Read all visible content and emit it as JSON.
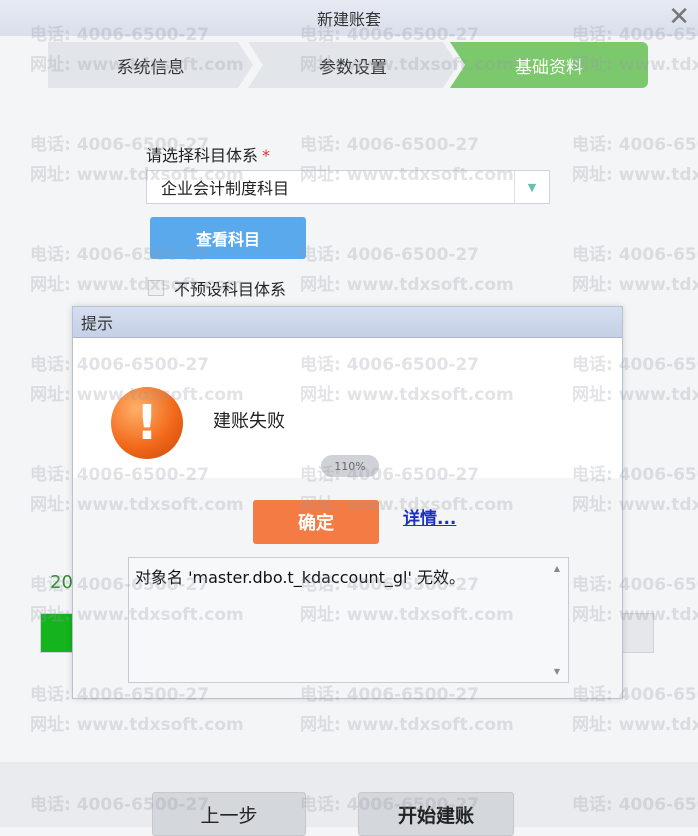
{
  "window": {
    "title": "新建账套",
    "close_glyph": "✕"
  },
  "steps": [
    {
      "label": "系统信息",
      "state": "done"
    },
    {
      "label": "参数设置",
      "state": "done"
    },
    {
      "label": "基础资料",
      "state": "active"
    }
  ],
  "form": {
    "subject_system_label": "请选择科目体系",
    "required_mark": "*",
    "subject_system_value": "企业会计制度科目",
    "view_subjects_button": "查看科目",
    "no_preset_label": "不预设科目体系"
  },
  "progress": {
    "value_label": "20",
    "fraction": 0.07
  },
  "footer": {
    "prev_button": "上一步",
    "start_button": "开始建账"
  },
  "dialog": {
    "title": "提示",
    "message": "建账失败",
    "zoom_badge": "110%",
    "ok_button": "确定",
    "details_link": "详情...",
    "detail_text": "对象名 'master.dbo.t_kdaccount_gl' 无效。"
  },
  "watermark": {
    "phone": "电话: 4006-6500-27",
    "site": "网址: www.tdxsoft.com"
  },
  "colors": {
    "accent_green": "#7cc86c",
    "button_blue": "#59a9ec",
    "ok_orange": "#f47b44",
    "progress_green": "#14b51c"
  }
}
